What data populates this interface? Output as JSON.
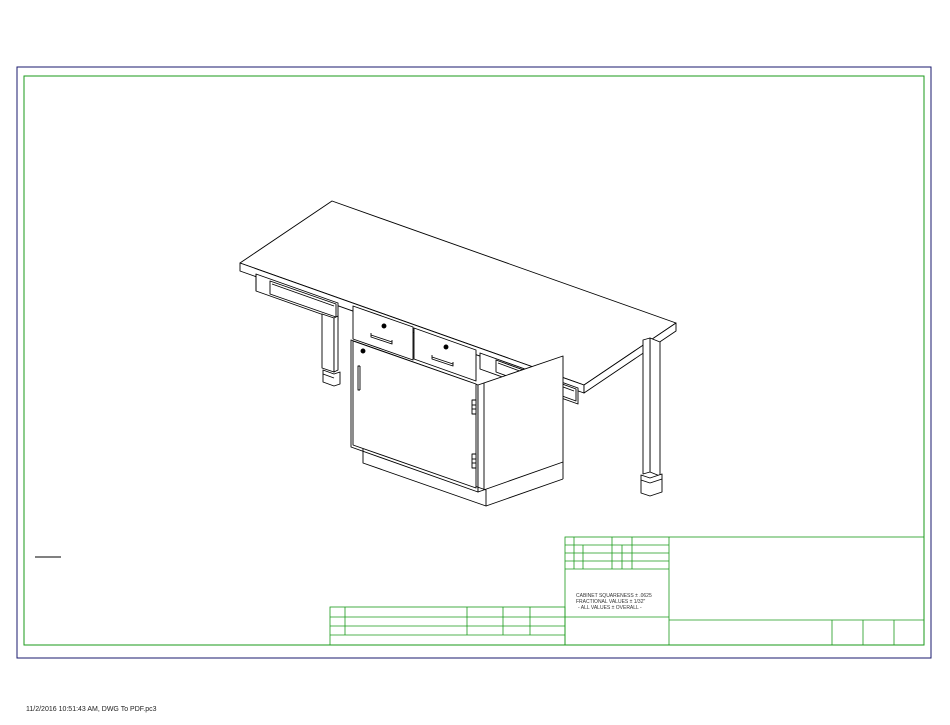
{
  "notes": {
    "line1": "CABINET SQUARENESS ± .0625",
    "line2": "FRACTIONAL VALUES ± 1/32\"",
    "line3": "- ALL VALUES ± OVERALL -"
  },
  "footer": {
    "plot_stamp": "11/2/2016 10:51:43 AM, DWG To PDF.pc3"
  },
  "colors": {
    "outer_border": "#1a1a6e",
    "inner_border": "#1a9a1a",
    "drawing_lines": "#000000"
  }
}
